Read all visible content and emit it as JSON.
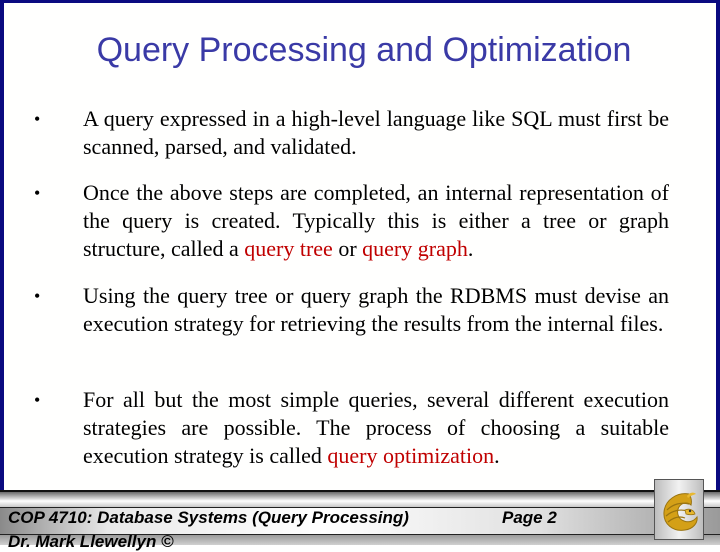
{
  "slide": {
    "title": "Query Processing and Optimization",
    "bullet_glyph": "•",
    "bullets": [
      {
        "text_before": "A query expressed in a high-level language like SQL must first be scanned, parsed, and validated.",
        "highlight1": "",
        "middle": "",
        "highlight2": "",
        "text_after": ""
      },
      {
        "text_before": "Once the above steps are completed, an internal representation of the query is created.  Typically this is either a tree or graph structure, called a ",
        "highlight1": "query tree",
        "middle": " or ",
        "highlight2": "query graph",
        "text_after": "."
      },
      {
        "text_before": "Using the query tree or query graph the RDBMS must devise an execution strategy for retrieving the results from the internal files.",
        "highlight1": "",
        "middle": "",
        "highlight2": "",
        "text_after": ""
      },
      {
        "text_before": "For all but the most simple queries, several different execution strategies are possible.  The process of choosing a suitable execution strategy is called ",
        "highlight1": "query optimization",
        "middle": "",
        "highlight2": "",
        "text_after": "."
      }
    ]
  },
  "footer": {
    "course": "COP 4710: Database Systems (Query Processing)",
    "page": "Page 2",
    "author": "Dr. Mark Llewellyn ©",
    "logo": "ucf-pegasus-logo"
  },
  "colors": {
    "title": "#3a3aa6",
    "highlight": "#c00000",
    "border": "#0a0a80",
    "logo_gold": "#d4a017"
  }
}
